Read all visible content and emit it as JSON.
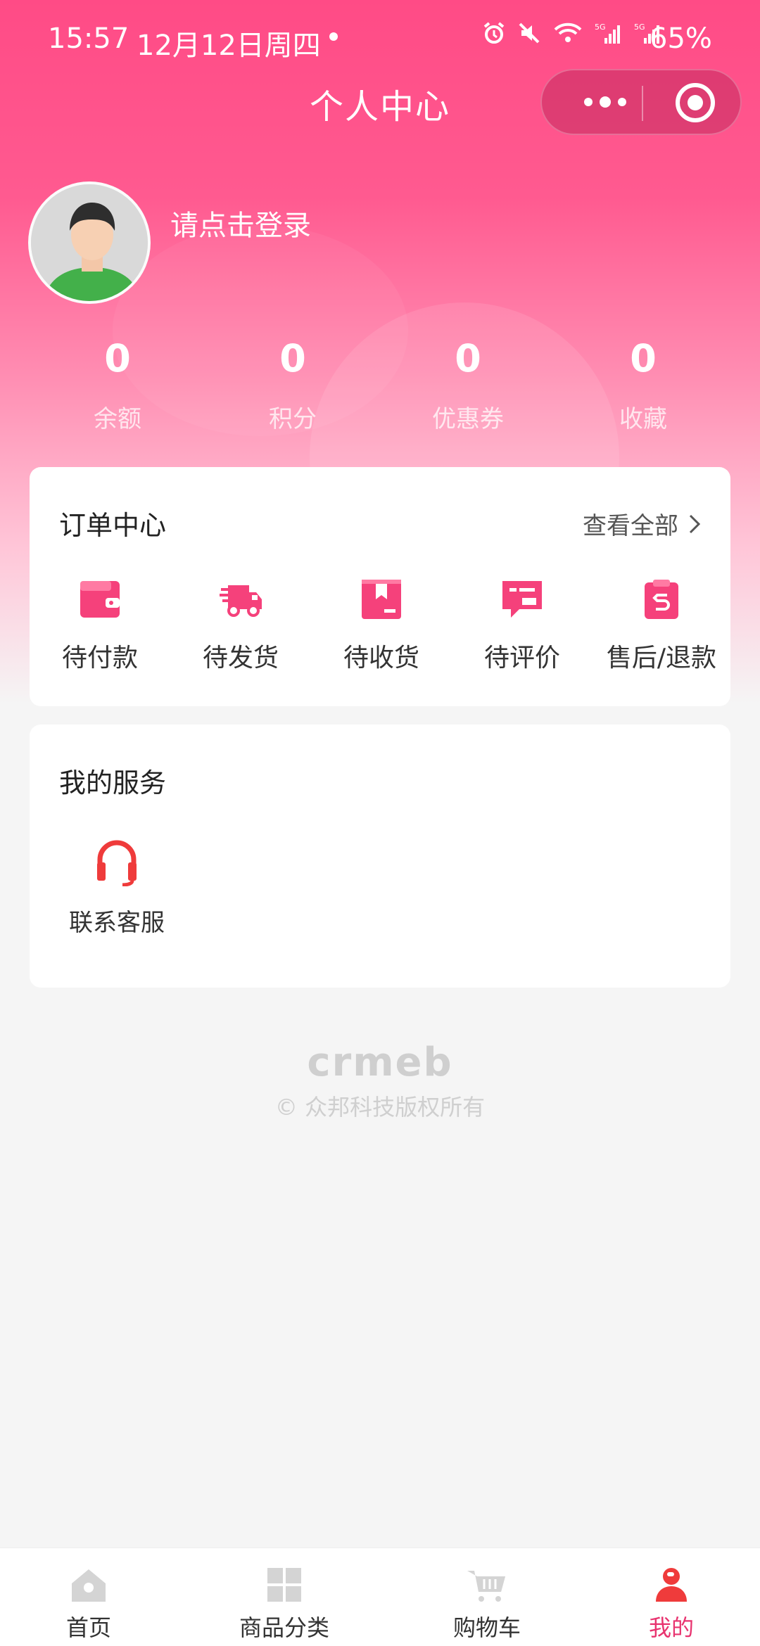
{
  "status_bar": {
    "time": "15:57",
    "date": "12月12日周四",
    "battery": "65%"
  },
  "header": {
    "title": "个人中心"
  },
  "profile": {
    "login_prompt": "请点击登录"
  },
  "stats": [
    {
      "value": "0",
      "label": "余额"
    },
    {
      "value": "0",
      "label": "积分"
    },
    {
      "value": "0",
      "label": "优惠券"
    },
    {
      "value": "0",
      "label": "收藏"
    }
  ],
  "order_center": {
    "title": "订单中心",
    "view_all": "查看全部",
    "items": [
      {
        "label": "待付款",
        "icon": "wallet-icon"
      },
      {
        "label": "待发货",
        "icon": "truck-icon"
      },
      {
        "label": "待收货",
        "icon": "package-icon"
      },
      {
        "label": "待评价",
        "icon": "review-icon"
      },
      {
        "label": "售后/退款",
        "icon": "refund-icon"
      }
    ]
  },
  "services": {
    "title": "我的服务",
    "items": [
      {
        "label": "联系客服",
        "icon": "headset-icon"
      }
    ]
  },
  "footer": {
    "brand": "crmeb",
    "copyright": "© 众邦科技版权所有"
  },
  "tabbar": {
    "items": [
      {
        "label": "首页",
        "icon": "home-icon",
        "active": false
      },
      {
        "label": "商品分类",
        "icon": "category-icon",
        "active": false
      },
      {
        "label": "购物车",
        "icon": "cart-icon",
        "active": false
      },
      {
        "label": "我的",
        "icon": "profile-icon",
        "active": true
      }
    ]
  },
  "colors": {
    "brand_pink": "#ff4b86",
    "icon_pink": "#f5417b",
    "service_red": "#ef3b3b",
    "active_tab": "#e8336f"
  }
}
